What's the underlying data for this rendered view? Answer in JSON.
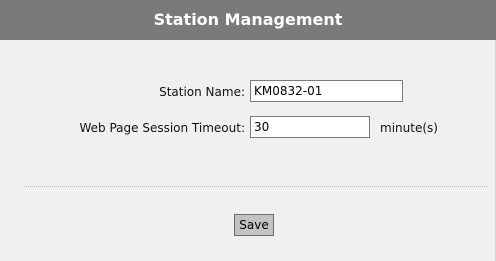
{
  "header": {
    "title": "Station Management"
  },
  "form": {
    "station_name_label": "Station Name:",
    "station_name_value": "KM0832-01",
    "timeout_label": "Web Page Session Timeout:",
    "timeout_value": "30",
    "timeout_unit": "minute(s)"
  },
  "actions": {
    "save_label": "Save"
  },
  "colors": {
    "header_bg": "#7a7a7a",
    "panel_bg": "#f0f0f0",
    "button_bg": "#c3c3c3"
  }
}
